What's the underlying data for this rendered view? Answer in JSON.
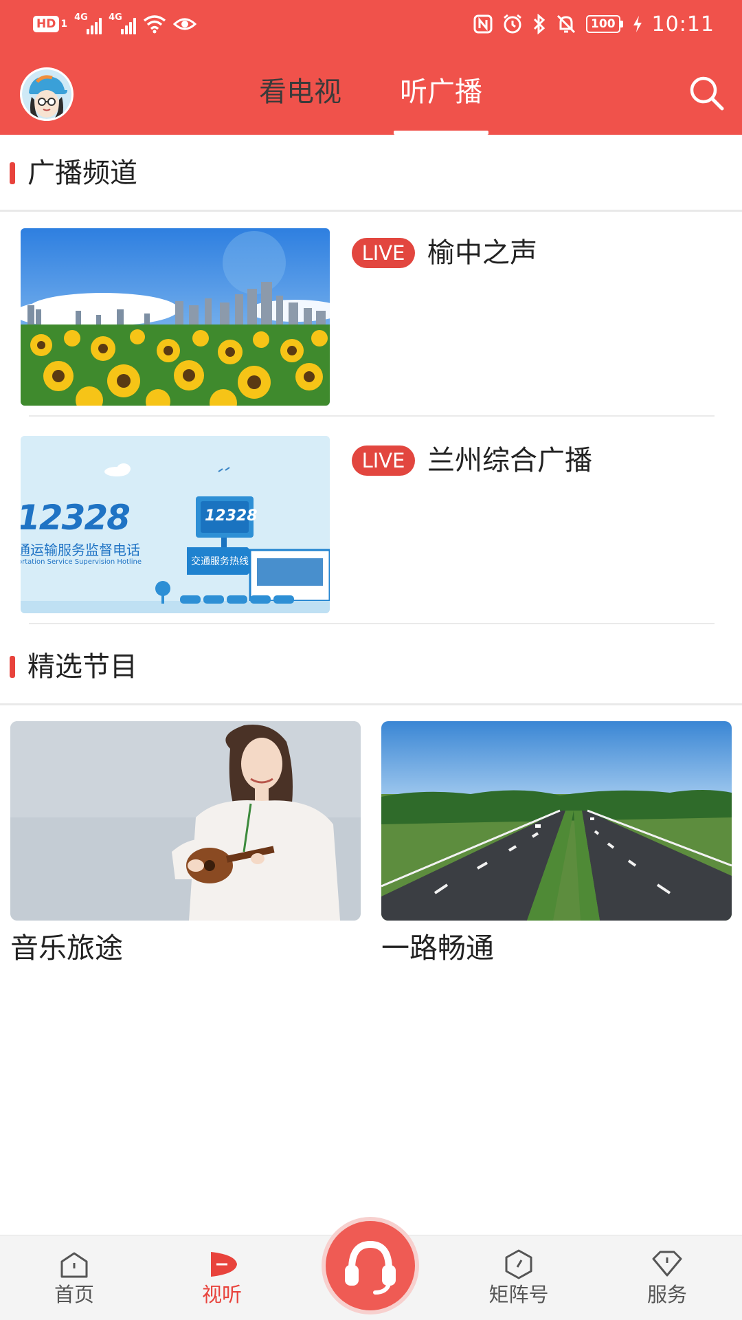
{
  "status_bar": {
    "hd": "HD",
    "hd_sub": "1",
    "sim1_gen": "4G",
    "sim2_gen": "4G",
    "battery": "100",
    "time": "10:11",
    "icons": [
      "hd-icon",
      "signal-icon",
      "signal-icon",
      "wifi-icon",
      "eye-icon",
      "nfc-icon",
      "alarm-icon",
      "bluetooth-icon",
      "mute-icon",
      "battery-icon",
      "charging-icon"
    ]
  },
  "header": {
    "tabs": [
      {
        "label": "看电视",
        "active": false
      },
      {
        "label": "听广播",
        "active": true
      }
    ],
    "accent_color": "#f0524b"
  },
  "sections": {
    "channels_title": "广播频道",
    "programs_title": "精选节目"
  },
  "channels": [
    {
      "live": "LIVE",
      "name": "榆中之声",
      "image": "sunflower-city-thumbnail"
    },
    {
      "live": "LIVE",
      "name": "兰州综合广播",
      "image": "transport-hotline-12328-thumbnail",
      "image_text": {
        "number": "12328",
        "cn": "通运输服务监督电话",
        "en": "ortation Service Supervision Hotline",
        "sign": "12328",
        "arrow": "交通服务热线"
      }
    }
  ],
  "programs": [
    {
      "title": "音乐旅途",
      "image": "woman-ukulele-photo"
    },
    {
      "title": "一路畅通",
      "image": "highway-photo"
    }
  ],
  "bottom_nav": {
    "items": [
      {
        "label": "首页",
        "icon": "home-icon",
        "active": false
      },
      {
        "label": "视听",
        "icon": "play-icon",
        "active": true
      },
      {
        "label": "矩阵号",
        "icon": "matrix-icon",
        "active": false
      },
      {
        "label": "服务",
        "icon": "service-icon",
        "active": false
      }
    ],
    "center_icon": "headphones-icon"
  }
}
